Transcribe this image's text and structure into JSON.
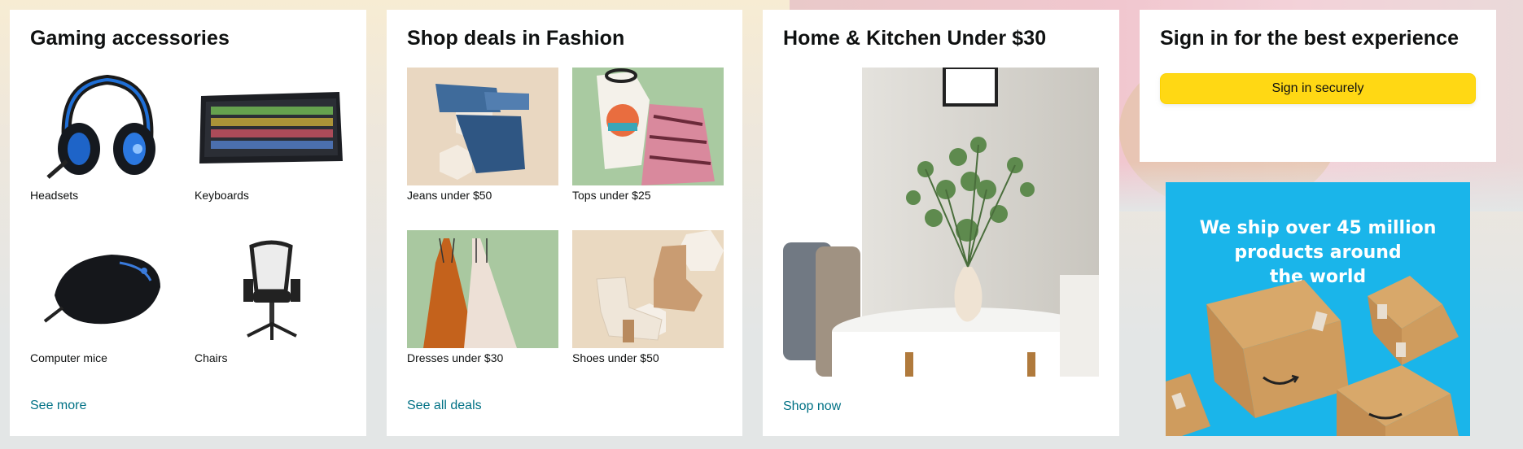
{
  "gaming": {
    "title": "Gaming accessories",
    "items": [
      {
        "label": "Headsets",
        "icon": "headset-icon"
      },
      {
        "label": "Keyboards",
        "icon": "keyboard-icon"
      },
      {
        "label": "Computer mice",
        "icon": "mouse-icon"
      },
      {
        "label": "Chairs",
        "icon": "chair-icon"
      }
    ],
    "link": "See more"
  },
  "fashion": {
    "title": "Shop deals in Fashion",
    "items": [
      {
        "label": "Jeans under $50",
        "icon": "jeans-image"
      },
      {
        "label": "Tops under $25",
        "icon": "tops-image"
      },
      {
        "label": "Dresses under $30",
        "icon": "dresses-image"
      },
      {
        "label": "Shoes under $50",
        "icon": "shoes-image"
      }
    ],
    "link": "See all deals"
  },
  "home": {
    "title": "Home & Kitchen Under $30",
    "link": "Shop now"
  },
  "signin": {
    "title": "Sign in for the best experience",
    "button": "Sign in securely"
  },
  "promo": {
    "line1": "We ship over 45 million",
    "line2": "products around",
    "line3": "the world"
  },
  "colors": {
    "link": "#007185",
    "button": "#ffd814",
    "promo_bg": "#1ab5ea"
  }
}
